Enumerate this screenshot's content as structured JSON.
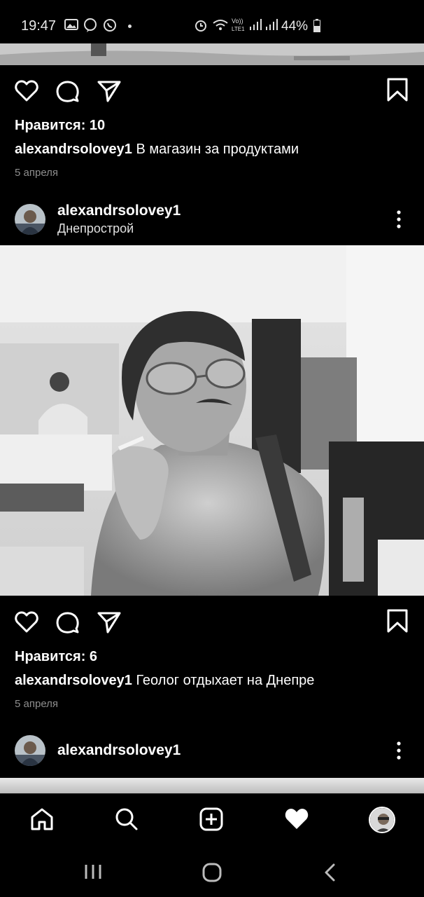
{
  "status_bar": {
    "time": "19:47",
    "battery": "44%",
    "network": "Vo)) LTE1"
  },
  "post1": {
    "likes": "Нравится: 10",
    "username": "alexandrsolovey1",
    "caption": "В магазин за продуктами",
    "date": "5 апреля"
  },
  "post2": {
    "username": "alexandrsolovey1",
    "location": "Днепрострой",
    "likes": "Нравится: 6",
    "caption_user": "alexandrsolovey1",
    "caption": "Геолог отдыхает на Днепре",
    "date": "5 апреля"
  },
  "post3": {
    "username": "alexandrsolovey1"
  },
  "icons": [
    "like-icon",
    "comment-icon",
    "share-icon",
    "bookmark-icon",
    "more-icon",
    "home-icon",
    "search-icon",
    "add-icon",
    "activity-icon",
    "profile-avatar"
  ],
  "colors": {
    "background": "#000000",
    "text": "#ffffff",
    "muted": "#8e8e8e"
  }
}
